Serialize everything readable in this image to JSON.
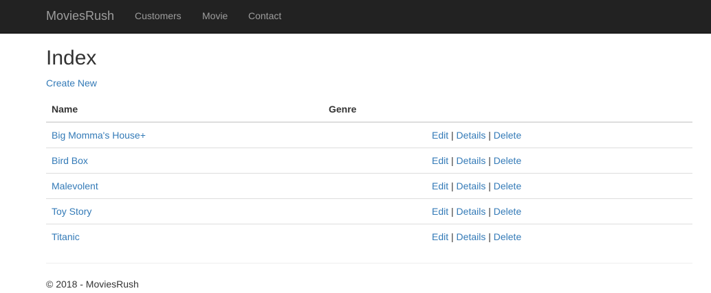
{
  "navbar": {
    "brand": "MoviesRush",
    "links": [
      "Customers",
      "Movie",
      "Contact"
    ]
  },
  "page": {
    "title": "Index",
    "create_link": "Create New"
  },
  "table": {
    "headers": {
      "name": "Name",
      "genre": "Genre"
    },
    "action_labels": {
      "edit": "Edit",
      "details": "Details",
      "delete": "Delete",
      "separator": "|"
    },
    "rows": [
      {
        "name": "Big Momma's House+",
        "genre": ""
      },
      {
        "name": "Bird Box",
        "genre": ""
      },
      {
        "name": "Malevolent",
        "genre": ""
      },
      {
        "name": "Toy Story",
        "genre": ""
      },
      {
        "name": "Titanic",
        "genre": ""
      }
    ]
  },
  "footer": {
    "text": "© 2018 - MoviesRush"
  },
  "colors": {
    "navbar_bg": "#222222",
    "navbar_text": "#9d9d9d",
    "link": "#337ab7",
    "text": "#333333"
  }
}
